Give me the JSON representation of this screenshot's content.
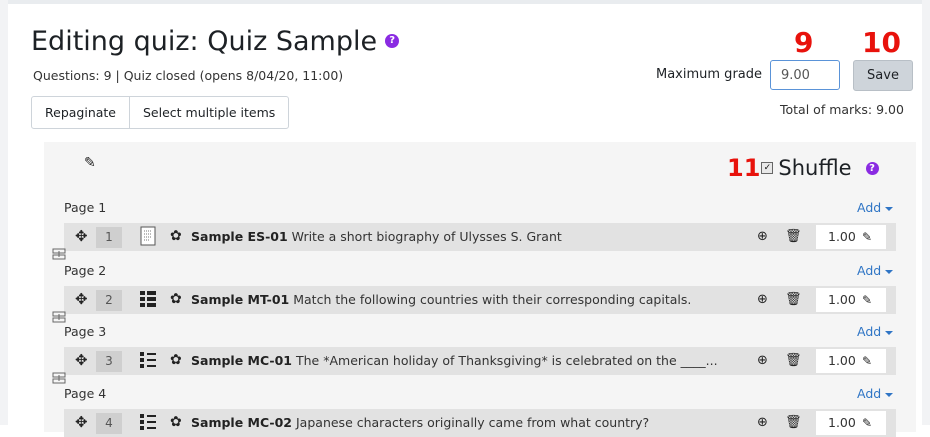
{
  "page": {
    "title": "Editing quiz: Quiz Sample",
    "help_icon": "question-circle-icon",
    "info": "Questions: 9 | Quiz closed (opens 8/04/20, 11:00)"
  },
  "toolbar": {
    "repaginate": "Repaginate",
    "select_multiple": "Select multiple items"
  },
  "grade": {
    "label": "Maximum grade",
    "value": "9.00",
    "save": "Save",
    "total": "Total of marks: 9.00"
  },
  "annotations": {
    "a9": "9",
    "a10": "10",
    "a11": "11"
  },
  "section": {
    "edit_icon": "pencil-icon",
    "shuffle_label": "Shuffle",
    "shuffle_checked": true
  },
  "add_label": "Add",
  "pages": [
    {
      "label": "Page 1",
      "question": {
        "num": "1",
        "type_icon": "essay-icon",
        "name": "Sample ES-01",
        "text": "Write a short biography of Ulysses S. Grant",
        "mark": "1.00"
      }
    },
    {
      "label": "Page 2",
      "question": {
        "num": "2",
        "type_icon": "matching-icon",
        "name": "Sample MT-01",
        "text": "Match the following countries with their corresponding capitals.",
        "mark": "1.00"
      }
    },
    {
      "label": "Page 3",
      "question": {
        "num": "3",
        "type_icon": "multichoice-icon",
        "name": "Sample MC-01",
        "text": "The *American holiday of Thanksgiving* is celebrated on the ____...",
        "mark": "1.00"
      }
    },
    {
      "label": "Page 4",
      "question": {
        "num": "4",
        "type_icon": "multichoice-icon",
        "name": "Sample MC-02",
        "text": "Japanese characters originally came from what country?",
        "mark": "1.00"
      }
    }
  ],
  "colors": {
    "accent": "#2f75c5",
    "annotation": "#e8120c",
    "help": "#8a2be2"
  }
}
